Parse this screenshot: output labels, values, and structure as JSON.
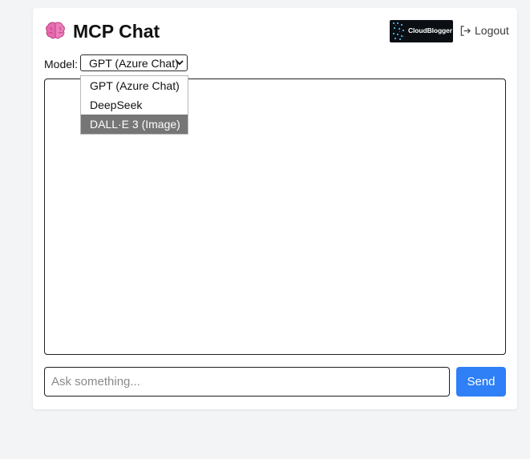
{
  "header": {
    "icon": "brain-icon",
    "title": "MCP Chat",
    "brand_logo_text": "CloudBlogger",
    "logout_label": "Logout",
    "logout_icon": "logout-icon"
  },
  "model": {
    "label": "Model:",
    "selected": "GPT (Azure Chat)",
    "options": [
      {
        "label": "GPT (Azure Chat)",
        "highlighted": false
      },
      {
        "label": "DeepSeek",
        "highlighted": false
      },
      {
        "label": "DALL·E 3 (Image)",
        "highlighted": true
      }
    ]
  },
  "chat": {
    "messages": []
  },
  "composer": {
    "placeholder": "Ask something...",
    "value": "",
    "send_label": "Send"
  },
  "colors": {
    "accent": "#2f7ff6",
    "page_bg": "#f3f4f6",
    "card_bg": "#ffffff",
    "highlight_option": "#767676",
    "brain_pink": "#e86ab0"
  }
}
